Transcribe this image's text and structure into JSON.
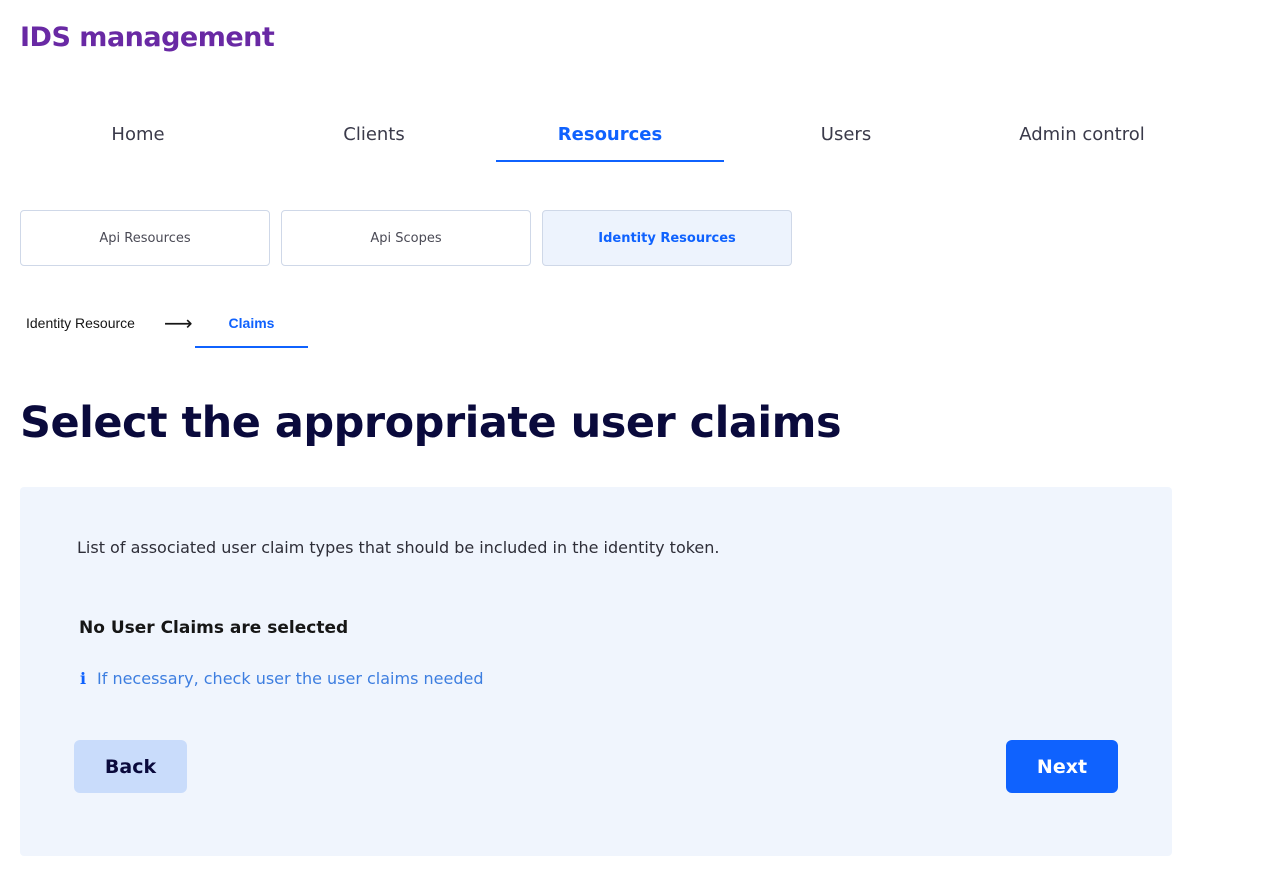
{
  "app": {
    "title": "IDS management"
  },
  "main_nav": {
    "tabs": [
      {
        "label": "Home",
        "active": false
      },
      {
        "label": "Clients",
        "active": false
      },
      {
        "label": "Resources",
        "active": true
      },
      {
        "label": "Users",
        "active": false
      },
      {
        "label": "Admin control",
        "active": false
      }
    ]
  },
  "resource_tabs": {
    "tabs": [
      {
        "label": "Api Resources",
        "active": false
      },
      {
        "label": "Api Scopes",
        "active": false
      },
      {
        "label": "Identity Resources",
        "active": true
      }
    ]
  },
  "steps": {
    "items": [
      {
        "label": "Identity Resource",
        "active": false
      },
      {
        "label": "Claims",
        "active": true
      }
    ],
    "separator_icon": "arrow-right-icon"
  },
  "page": {
    "heading": "Select the appropriate user claims"
  },
  "claims_panel": {
    "description": "List of associated user claim types that should be included in the identity token.",
    "empty_title": "No User Claims are selected",
    "hint_icon": "info-icon",
    "hint_text": "If necessary, check user the user claims needed"
  },
  "actions": {
    "back_label": "Back",
    "next_label": "Next"
  },
  "colors": {
    "brand": "#6929a4",
    "accent": "#0f62fe",
    "panel_background": "#f0f5fd",
    "secondary_button": "#c9dcfb",
    "heading": "#0a0a3c"
  }
}
